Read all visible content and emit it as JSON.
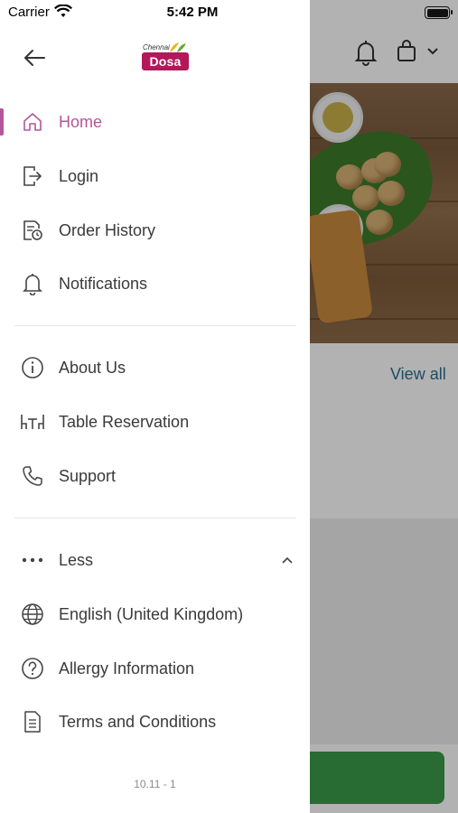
{
  "status_bar": {
    "carrier": "Carrier",
    "time": "5:42 PM"
  },
  "logo": {
    "small_text": "Chennai",
    "badge_text": "Dosa",
    "brand_color": "#b3185b"
  },
  "accent_color": "#b4569a",
  "menu": {
    "home": "Home",
    "login": "Login",
    "order_history": "Order History",
    "notifications": "Notifications",
    "about_us": "About Us",
    "table_reservation": "Table Reservation",
    "support": "Support",
    "less": "Less",
    "language": "English (United Kingdom)",
    "allergy_information": "Allergy Information",
    "terms_and_conditions": "Terms and Conditions"
  },
  "version": "10.11 - 1",
  "background": {
    "view_all": "View all"
  }
}
